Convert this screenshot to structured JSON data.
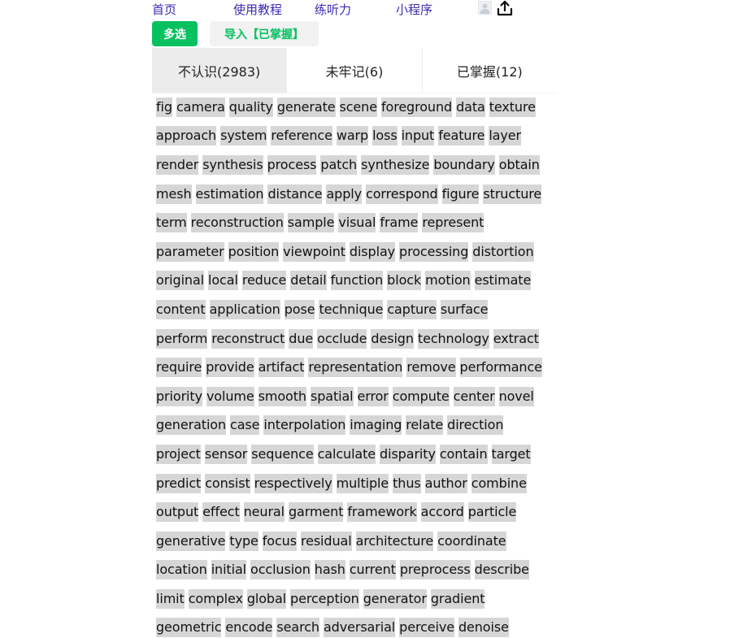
{
  "nav": {
    "home": "首页",
    "tutorial": "使用教程",
    "listening": "练听力",
    "miniprogram": "小程序",
    "avatar_icon": "avatar-icon",
    "upload_icon": "upload-icon"
  },
  "actions": {
    "multi_select": "多选",
    "import_mastered": "导入【已掌握】"
  },
  "tabs": [
    {
      "label": "不认识(2983)",
      "active": true
    },
    {
      "label": "未牢记(6)",
      "active": false
    },
    {
      "label": "已掌握(12)",
      "active": false
    }
  ],
  "colors": {
    "accent_green": "#07c160",
    "nav_link": "#3a2bb0",
    "word_bg": "#d6d6d6",
    "active_tab_bg": "#ececec"
  },
  "word_rows": [
    [
      "fig",
      "camera",
      "quality",
      "generate",
      "scene",
      "foreground",
      "data",
      "texture"
    ],
    [
      "approach",
      "system",
      "reference",
      "warp",
      "loss",
      "input",
      "feature",
      "layer"
    ],
    [
      "render",
      "synthesis",
      "process",
      "patch",
      "synthesize",
      "boundary",
      "obtain"
    ],
    [
      "mesh",
      "estimation",
      "distance",
      "apply",
      "correspond",
      "figure",
      "structure"
    ],
    [
      "term",
      "reconstruction",
      "sample",
      "visual",
      "frame",
      "represent"
    ],
    [
      "parameter",
      "position",
      "viewpoint",
      "display",
      "processing",
      "distortion"
    ],
    [
      "original",
      "local",
      "reduce",
      "detail",
      "function",
      "block",
      "motion",
      "estimate"
    ],
    [
      "content",
      "application",
      "pose",
      "technique",
      "capture",
      "surface"
    ],
    [
      "perform",
      "reconstruct",
      "due",
      "occlude",
      "design",
      "technology",
      "extract"
    ],
    [
      "require",
      "provide",
      "artifact",
      "representation",
      "remove",
      "performance"
    ],
    [
      "priority",
      "volume",
      "smooth",
      "spatial",
      "error",
      "compute",
      "center",
      "novel"
    ],
    [
      "generation",
      "case",
      "interpolation",
      "imaging",
      "relate",
      "direction"
    ],
    [
      "project",
      "sensor",
      "sequence",
      "calculate",
      "disparity",
      "contain",
      "target"
    ],
    [
      "predict",
      "consist",
      "respectively",
      "multiple",
      "thus",
      "author",
      "combine"
    ],
    [
      "output",
      "effect",
      "neural",
      "garment",
      "framework",
      "accord",
      "particle"
    ],
    [
      "generative",
      "type",
      "focus",
      "residual",
      "architecture",
      "coordinate"
    ],
    [
      "location",
      "initial",
      "occlusion",
      "hash",
      "current",
      "preprocess",
      "describe"
    ],
    [
      "limit",
      "complex",
      "global",
      "perception",
      "generator",
      "gradient"
    ],
    [
      "geometric",
      "encode",
      "search",
      "adversarial",
      "perceive",
      "denoise"
    ]
  ]
}
